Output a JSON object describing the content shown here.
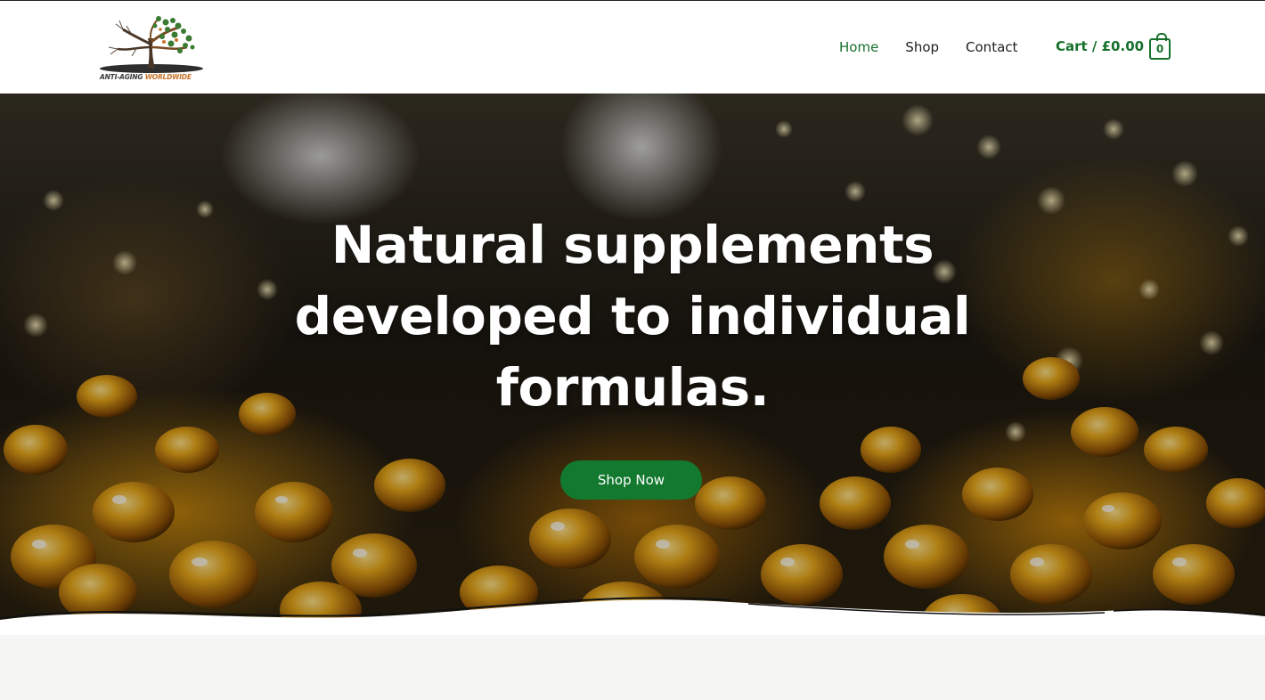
{
  "header": {
    "logo": {
      "text_part1": "ANTI-AGING ",
      "text_part2": "WORLDWIDE"
    },
    "nav": [
      {
        "label": "Home",
        "active": true
      },
      {
        "label": "Shop",
        "active": false
      },
      {
        "label": "Contact",
        "active": false
      }
    ],
    "cart": {
      "label": "Cart / £0.00",
      "count": "0"
    }
  },
  "hero": {
    "title": "Natural supplements developed to individual formulas.",
    "cta_label": "Shop Now"
  },
  "colors": {
    "brand_green": "#15702c",
    "button_green": "#12792e",
    "logo_orange": "#c8732a",
    "section_background": "#f5f6f4"
  }
}
